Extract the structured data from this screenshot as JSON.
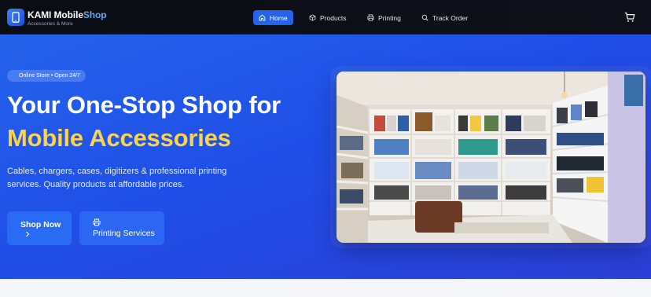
{
  "brand": {
    "name_main": "KAMI Mobile",
    "name_accent": "Shop",
    "tagline": "Accessories & More",
    "logo_icon": "phone-icon"
  },
  "nav": {
    "items": [
      {
        "label": "Home",
        "icon": "home-icon",
        "active": true
      },
      {
        "label": "Products",
        "icon": "box-icon",
        "active": false
      },
      {
        "label": "Printing",
        "icon": "printer-icon",
        "active": false
      },
      {
        "label": "Track Order",
        "icon": "search-icon",
        "active": false
      }
    ],
    "cart_icon": "cart-icon"
  },
  "hero": {
    "badge": "Online Store • Open 24/7",
    "title_line1": "Your One-Stop Shop for",
    "title_line2": "Mobile Accessories",
    "subtitle": "Cables, chargers, cases, digitizers & professional printing services. Quality products at affordable prices.",
    "primary_button": "Shop Now",
    "primary_button_icon": "chevron-right-icon",
    "secondary_button": "Printing Services",
    "secondary_button_icon": "printer-icon",
    "image": "shop-interior-photo"
  },
  "colors": {
    "accent": "#2563eb",
    "highlight": "#fcd34d",
    "nav_bg": "#0b0d14"
  }
}
